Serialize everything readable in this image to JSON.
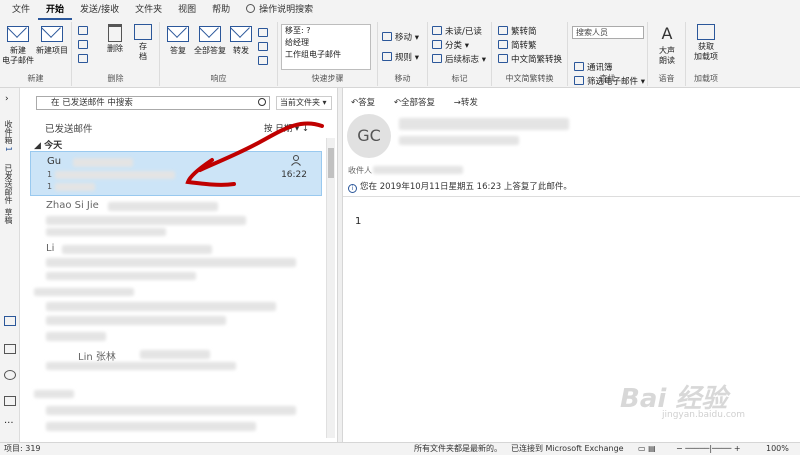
{
  "menu": {
    "items": [
      "文件",
      "开始",
      "发送/接收",
      "文件夹",
      "视图",
      "帮助"
    ],
    "active_index": 1,
    "tellme": "操作说明搜索"
  },
  "ribbon": {
    "new": {
      "new_mail": "新建\n电子邮件",
      "new_items": "新建项目",
      "group": "新建"
    },
    "delete": {
      "delete": "删除",
      "archive": "存\n档",
      "group": "删除"
    },
    "respond": {
      "reply": "答复",
      "reply_all": "全部答复",
      "forward": "转发",
      "group": "响应"
    },
    "quicksteps": {
      "items": [
        "移至: ?",
        "给经理",
        "工作组电子邮件"
      ],
      "group": "快速步骤"
    },
    "move": {
      "move": "移动",
      "rules": "规则",
      "group": "移动"
    },
    "tags": {
      "unread": "未读/已读",
      "categorize": "分类",
      "followup": "后续标志",
      "group": "标记"
    },
    "chinese": {
      "t2s": "繁转简",
      "s2t": "简转繁",
      "convert": "中文简繁转换",
      "group": "中文简繁转换"
    },
    "find": {
      "search_people": "搜索人员",
      "address_book": "通讯簿",
      "filter": "筛选电子邮件",
      "group": "查找"
    },
    "speech": {
      "read_aloud": "大声\n朗读",
      "group": "语音"
    },
    "addins": {
      "get_addins": "获取\n加载项",
      "group": "加载项"
    }
  },
  "leftnav": {
    "inbox": "收件箱",
    "inbox_count": "1",
    "sent": "已发送邮件",
    "drafts": "草稿"
  },
  "list": {
    "search_placeholder": "在 已发送邮件 中搜索",
    "scope": "当前文件夹",
    "folder_title": "已发送邮件",
    "sort": "按 日期",
    "today": "今天",
    "selected": {
      "sender": "Gu",
      "line2": "1",
      "line3": "1",
      "time": "16:22"
    },
    "row2_sender": "Zhao Si Jie",
    "row3_sender": "Li",
    "row4_sender": "Lin 张林"
  },
  "reading": {
    "reply": "答复",
    "reply_all": "全部答复",
    "forward": "转发",
    "avatar": "GC",
    "recipient_label": "收件人",
    "info": "您在 2019年10月11日星期五 16:23 上答复了此邮件。",
    "body": "1"
  },
  "status": {
    "items": "项目: 319",
    "uptodate": "所有文件夹都是最新的。",
    "connected": "已连接到 Microsoft Exchange",
    "zoom": "100%"
  },
  "watermark": {
    "logo": "Bai 经验",
    "url": "jingyan.baidu.com"
  },
  "colors": {
    "accent": "#2b579a",
    "selected": "#cce4f7",
    "annotation": "#c00000"
  }
}
